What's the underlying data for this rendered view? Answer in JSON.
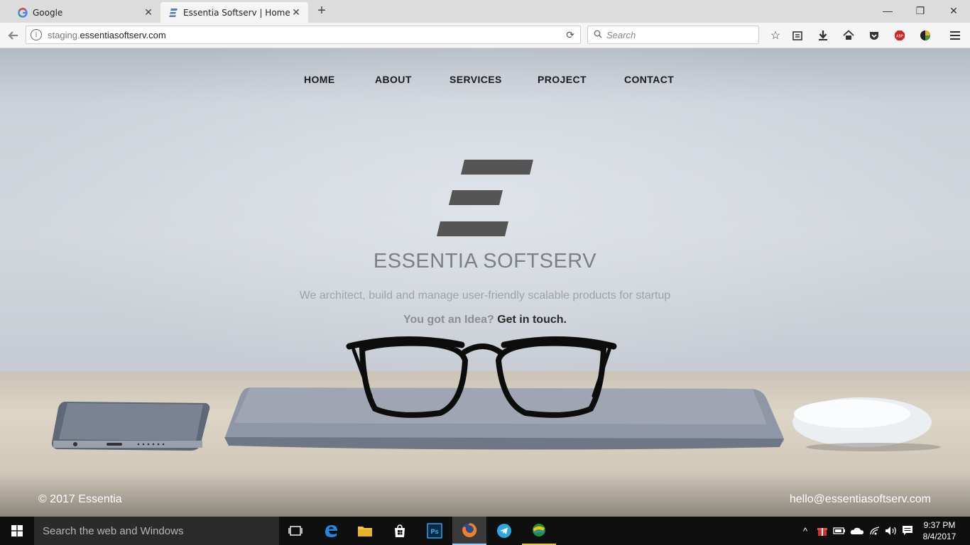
{
  "browser": {
    "tabs": [
      {
        "label": "Google",
        "icon": "google-g-icon"
      },
      {
        "label": "Essentia Softserv | Home",
        "icon": "essentia-logo-icon"
      }
    ],
    "url": {
      "prefix": "staging.",
      "host": "essentiasoftserv.com"
    },
    "search_placeholder": "Search"
  },
  "site": {
    "nav": [
      "HOME",
      "ABOUT",
      "SERVICES",
      "PROJECT",
      "CONTACT"
    ],
    "brand": "ESSENTIA SOFTSERV",
    "tagline": "We architect, build and manage user-friendly scalable products for startup",
    "cta_question": "You got an Idea?",
    "cta_link": "Get in touch.",
    "footer_left": "© 2017 Essentia",
    "footer_right": "hello@essentiasoftserv.com",
    "logo_color": "#555555"
  },
  "taskbar": {
    "search_placeholder": "Search the web and Windows",
    "time": "9:37 PM",
    "date": "8/4/2017"
  }
}
